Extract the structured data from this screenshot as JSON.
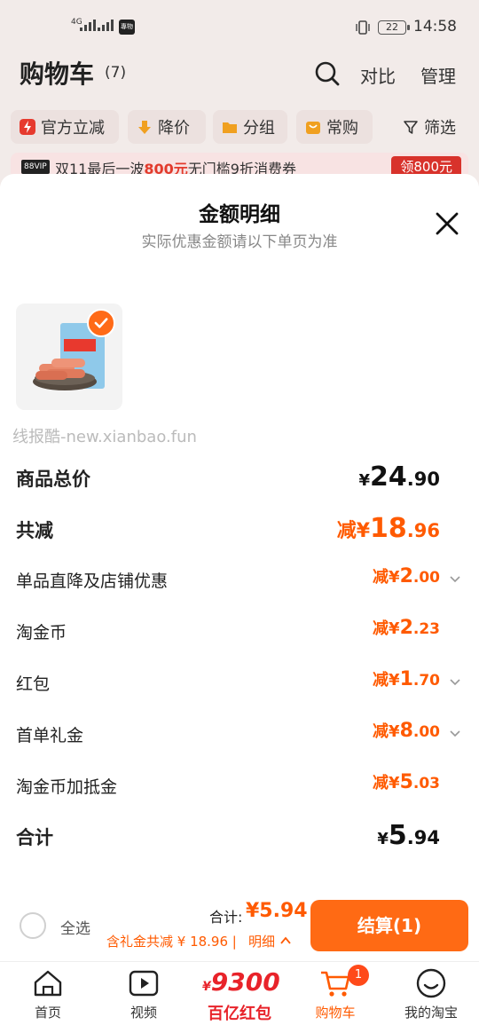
{
  "status_bar": {
    "network": "4G",
    "app_badge": "專物",
    "battery": "22",
    "time": "14:58"
  },
  "header": {
    "title": "购物车",
    "count": "(7)",
    "compare_label": "对比",
    "manage_label": "管理"
  },
  "filter_chips": [
    {
      "label": "官方立减",
      "icon": "lightning-icon",
      "color": "#e63a2e"
    },
    {
      "label": "降价",
      "icon": "down-arrow-icon",
      "color": "#f0a020"
    },
    {
      "label": "分组",
      "icon": "folder-icon",
      "color": "#f0a020"
    },
    {
      "label": "常购",
      "icon": "basket-icon",
      "color": "#f0a020"
    },
    {
      "label": "筛选",
      "icon": "filter-icon",
      "color": "#333333"
    }
  ],
  "promo": {
    "vip_badge": "88VIP",
    "text_prefix": "双11最后一波",
    "highlight": "800元",
    "text_suffix": "无门槛9折消费券",
    "button": "领800元"
  },
  "sheet": {
    "title": "金额明细",
    "subtitle": "实际优惠金额请以下单页为准",
    "watermark": "线报酷-new.xianbao.fun",
    "rows": [
      {
        "label": "商品总价",
        "prefix": "",
        "sym": "¥",
        "int": "24",
        "dec": ".90",
        "bold": true,
        "black": true,
        "chevron": false
      },
      {
        "label": "共减",
        "prefix": "减",
        "sym": "¥",
        "int": "18",
        "dec": ".96",
        "bold": true,
        "black": false,
        "chevron": false
      },
      {
        "label": "单品直降及店铺优惠",
        "prefix": "减",
        "sym": "¥",
        "int": "2",
        "dec": ".00",
        "bold": false,
        "black": false,
        "chevron": true
      },
      {
        "label": "淘金币",
        "prefix": "减",
        "sym": "¥",
        "int": "2",
        "dec": ".23",
        "bold": false,
        "black": false,
        "chevron": false
      },
      {
        "label": "红包",
        "prefix": "减",
        "sym": "¥",
        "int": "1",
        "dec": ".70",
        "bold": false,
        "black": false,
        "chevron": true
      },
      {
        "label": "首单礼金",
        "prefix": "减",
        "sym": "¥",
        "int": "8",
        "dec": ".00",
        "bold": false,
        "black": false,
        "chevron": true
      },
      {
        "label": "淘金币加抵金",
        "prefix": "减",
        "sym": "¥",
        "int": "5",
        "dec": ".03",
        "bold": false,
        "black": false,
        "chevron": false
      },
      {
        "label": "合计",
        "prefix": "",
        "sym": "¥",
        "int": "5",
        "dec": ".94",
        "bold": true,
        "black": true,
        "chevron": false
      }
    ]
  },
  "checkout": {
    "select_all": "全选",
    "total_label": "合计:",
    "total_value": "¥5.94",
    "gift_line": "含礼金共减 ¥ 18.96 | ",
    "detail_link": "明细",
    "pay_button": "结算(1)"
  },
  "tabbar": {
    "tabs": [
      {
        "label": "首页",
        "icon": "home-icon"
      },
      {
        "label": "视频",
        "icon": "play-icon"
      },
      {
        "label": "购物车",
        "icon": "cart-icon"
      },
      {
        "label": "我的淘宝",
        "icon": "smile-icon"
      }
    ],
    "cart_badge": "1",
    "hongbao_currency": "¥",
    "hongbao_amount": "9300",
    "hongbao_label": "百亿红包"
  },
  "colors": {
    "accent": "#ff6a14",
    "price": "#ff5a00",
    "red": "#e8232a"
  }
}
